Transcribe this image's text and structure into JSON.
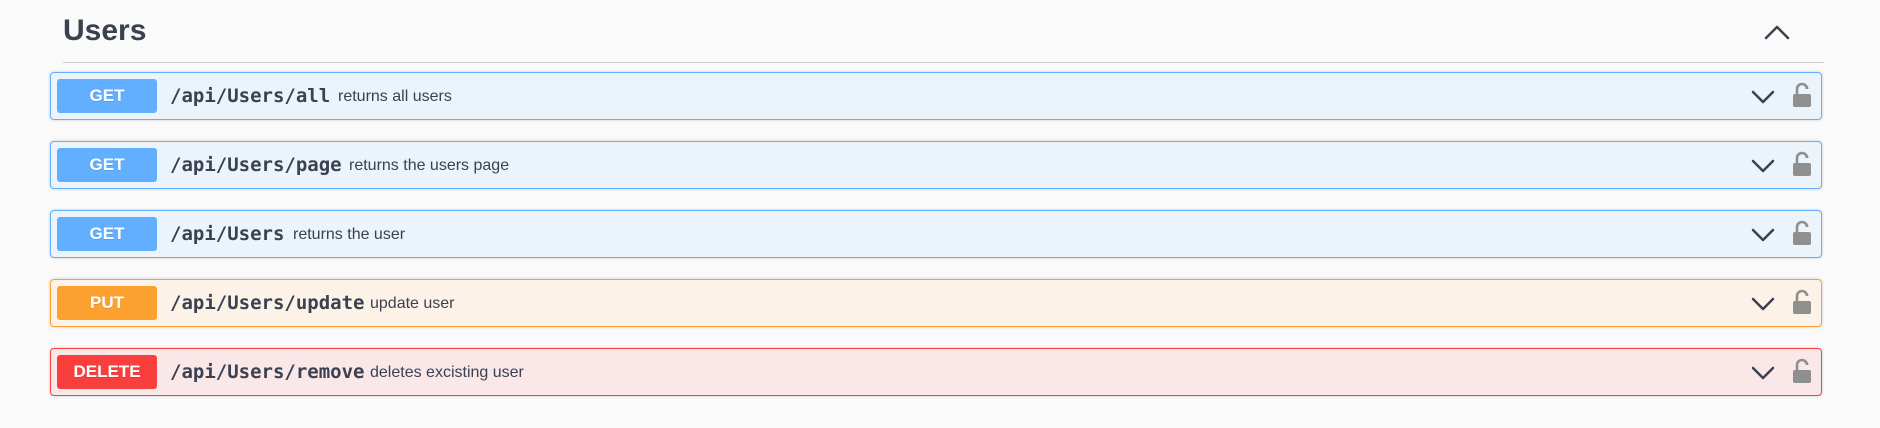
{
  "section": {
    "title": "Users",
    "toggle_icon": "chevron-up-icon"
  },
  "colors": {
    "get": "#61affe",
    "put": "#fca130",
    "delete": "#f93e3e",
    "text": "#3b4151"
  },
  "operations": [
    {
      "method": "GET",
      "path": "/api/Users/all",
      "summary": "returns all users"
    },
    {
      "method": "GET",
      "path": "/api/Users/page",
      "summary": "returns the users page"
    },
    {
      "method": "GET",
      "path": "/api/Users",
      "summary": "returns the user"
    },
    {
      "method": "PUT",
      "path": "/api/Users/update",
      "summary": "update user"
    },
    {
      "method": "DELETE",
      "path": "/api/Users/remove",
      "summary": "deletes excisting user"
    }
  ]
}
